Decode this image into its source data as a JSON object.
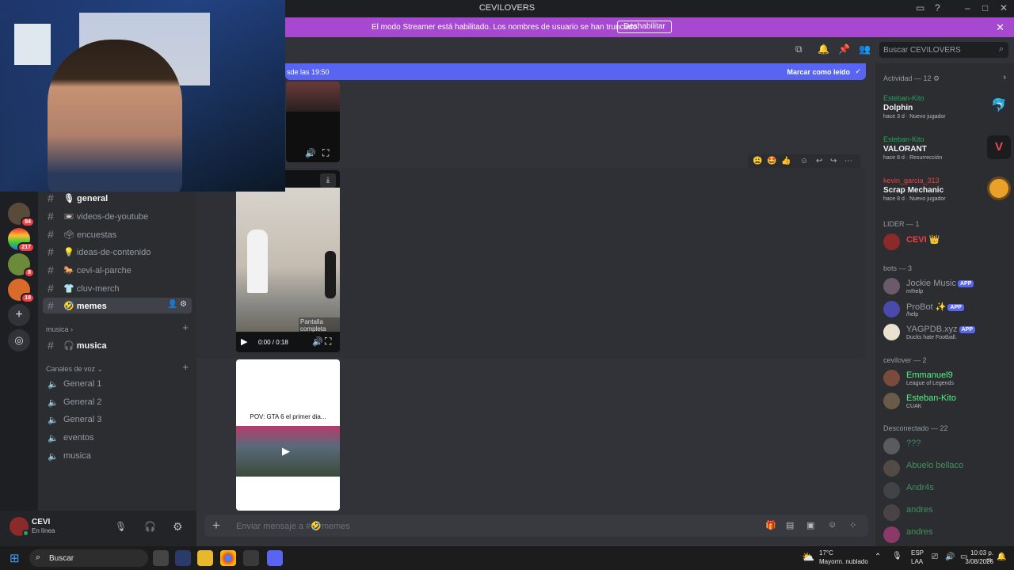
{
  "window": {
    "title": "CEVILOVERS"
  },
  "banner": {
    "message": "El modo Streamer está habilitado. Los nombres de usuario se han truncado.",
    "button": "Deshabilitar"
  },
  "newbar": {
    "left_text": "sde las 19:50",
    "right_text": "Marcar como leído"
  },
  "search": {
    "placeholder": "Buscar CEVILOVERS"
  },
  "servers": {
    "badges": [
      "84",
      "217",
      "8",
      "18"
    ]
  },
  "channels": {
    "text": [
      {
        "icon": "🎙",
        "name": "general"
      },
      {
        "icon": "📼",
        "name": "videos-de-youtube"
      },
      {
        "icon": "🗳",
        "name": "encuestas"
      },
      {
        "icon": "💡",
        "name": "ideas-de-contenido"
      },
      {
        "icon": "🐎",
        "name": "cevi-al-parche"
      },
      {
        "icon": "👕",
        "name": "cluv-merch"
      },
      {
        "icon": "🤣",
        "name": "memes"
      }
    ],
    "cat_musica": "musica",
    "musica_channel": "🎧 musica",
    "cat_voice": "Canales de voz",
    "voice": [
      "General 1",
      "General 2",
      "General 3",
      "eventos",
      "musica"
    ]
  },
  "user": {
    "name": "CEVI",
    "status": "En línea"
  },
  "media": {
    "fullscreen_tooltip": "Pantalla completa",
    "time": "0:00 / 0:18",
    "video2_caption": "POV: GTA 6 el primer dia..."
  },
  "composer": {
    "placeholder": "Enviar mensaje a #🤣memes"
  },
  "members": {
    "activity_header": "Actividad — 12",
    "activities": [
      {
        "who": "Esteban-Kito",
        "game": "Dolphin",
        "meta": "hace 3 d · Nuevo jugador",
        "color": "#3a8cd8"
      },
      {
        "who": "Esteban-Kito",
        "game": "VALORANT",
        "meta": "hace 8 d · Resurrección",
        "color": "#e94a57"
      },
      {
        "who": "kevin_garcia_313",
        "game": "Scrap Mechanic",
        "meta": "hace 8 d · Nuevo jugador",
        "color": "#e9a12a"
      }
    ],
    "lider_header": "LIDER — 1",
    "lider": [
      {
        "name": "CEVI 👑"
      }
    ],
    "bots_header": "bots — 3",
    "bots": [
      {
        "name": "Jockie Music",
        "tag": "APP",
        "status": "m!help"
      },
      {
        "name": "ProBot ✨",
        "tag": "APP",
        "status": "/help"
      },
      {
        "name": "YAGPDB.xyz",
        "tag": "APP",
        "status": "Ducks hate Football."
      }
    ],
    "cevilover_header": "cevilover — 2",
    "cevilover": [
      {
        "name": "Emmanuel9",
        "status": "League of Legends"
      },
      {
        "name": "Esteban-Kito",
        "status": "CUAK"
      }
    ],
    "offline_header": "Desconectado — 22",
    "offline": [
      "???",
      "Abuelo bellaco",
      "Andr4s",
      "andres",
      "andres"
    ]
  },
  "taskbar": {
    "search": "Buscar",
    "weather_temp": "17°C",
    "weather_desc": "Mayorm. nublado",
    "lang": "ESP",
    "lang2": "LAA",
    "time": "10:03 p. m.",
    "date": "3/08/2026"
  }
}
